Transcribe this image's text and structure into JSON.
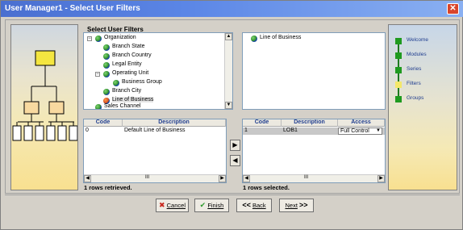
{
  "window": {
    "title": "User Manager1 - Select User Filters",
    "close_label": "✕"
  },
  "section_title": "Select User Filters",
  "tree": [
    {
      "label": "Organization",
      "expander": "−"
    },
    {
      "label": "Branch State"
    },
    {
      "label": "Branch Country"
    },
    {
      "label": "Legal Entity"
    },
    {
      "label": "Operating Unit",
      "expander": "−"
    },
    {
      "label": "Business Group"
    },
    {
      "label": "Branch City"
    },
    {
      "label": "Line of Business"
    },
    {
      "label": "Sales Channel"
    }
  ],
  "selected_tree": [
    {
      "label": "Line of Business"
    }
  ],
  "left_grid": {
    "headers": [
      "Code",
      "Description"
    ],
    "rows": [
      {
        "code": "0",
        "description": "Default Line of Business"
      }
    ],
    "status": "1 rows retrieved."
  },
  "right_grid": {
    "headers": [
      "Code",
      "Description",
      "Access"
    ],
    "rows": [
      {
        "code": "1",
        "description": "LOB1",
        "access": "Full Control"
      }
    ],
    "status": "1 rows selected."
  },
  "move_buttons": {
    "right": "▶",
    "left": "◀"
  },
  "nav": [
    {
      "label": "Welcome",
      "color": "#1f9a1f"
    },
    {
      "label": "Modules",
      "color": "#1f9a1f"
    },
    {
      "label": "Series",
      "color": "#1f9a1f"
    },
    {
      "label": "Filters",
      "color": "#f4e86a"
    },
    {
      "label": "Groups",
      "color": "#1f9a1f"
    }
  ],
  "buttons": {
    "cancel": "Cancel",
    "finish": "Finish",
    "back": "Back",
    "next": "Next",
    "cancel_icon": "✖",
    "finish_icon": "✔",
    "back_icon": "<<",
    "next_icon": ">>"
  },
  "hscroll_grip": "III",
  "colors": {
    "org_box": "#f4e640",
    "unit_box": "#f8d9a0"
  }
}
